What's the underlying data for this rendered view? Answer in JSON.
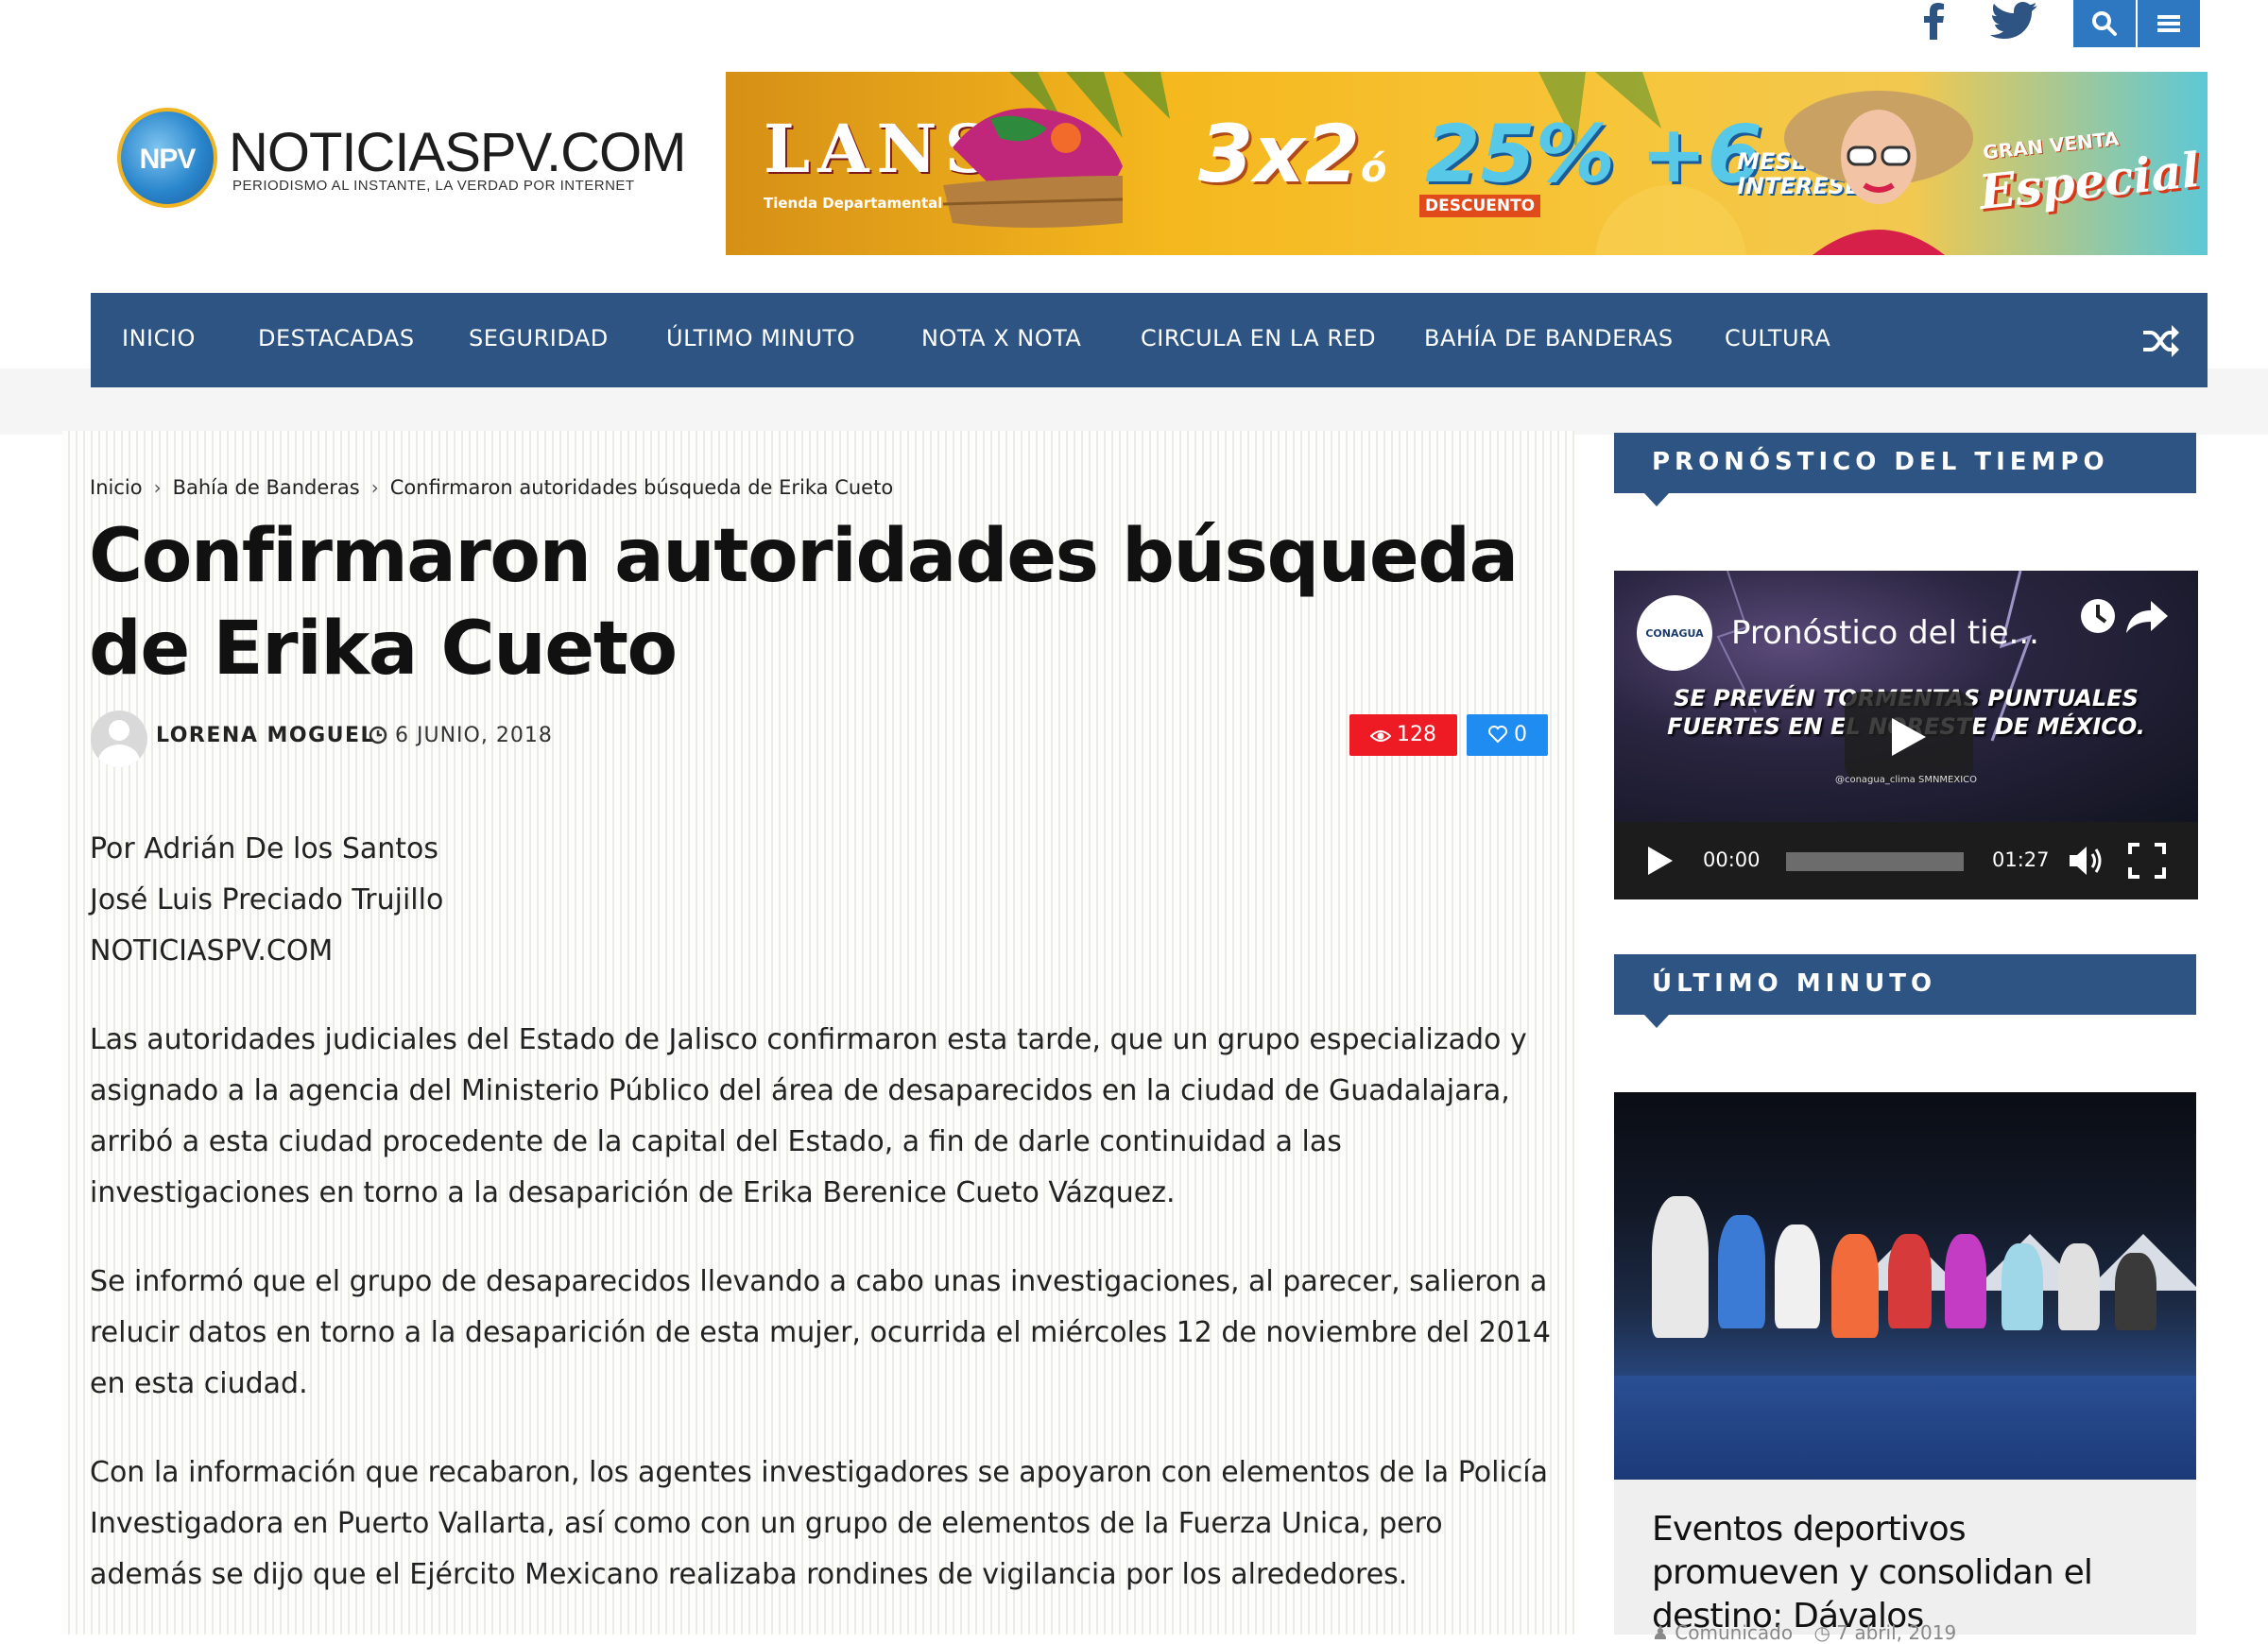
{
  "topbar": {
    "facebook_icon": "facebook-icon",
    "twitter_icon": "twitter-icon",
    "search_icon": "search-icon",
    "menu_icon": "hamburger-menu-icon",
    "accent_color": "#2e78c2"
  },
  "header": {
    "logo_mark": "NPV",
    "logo_name": "NOTICIASPV.COM",
    "logo_tagline": "PERIODISMO AL INSTANTE, LA VERDAD POR INTERNET"
  },
  "banner": {
    "brand": "LANS",
    "brand_sub": "Tienda Departamental",
    "promo_a": "3x2",
    "promo_or": "ó",
    "promo_b": "25%",
    "promo_b_sub": "DESCUENTO",
    "promo_c": "+6",
    "promo_c_sub_1": "MESES SIN",
    "promo_c_sub_2": "INTERESES",
    "sale_line_1": "GRAN VENTA",
    "sale_line_2": "Especial"
  },
  "nav": {
    "color": "#2d5482",
    "items": [
      "INICIO",
      "DESTACADAS",
      "SEGURIDAD",
      "ÚLTIMO MINUTO",
      "NOTA X NOTA",
      "CIRCULA EN LA RED",
      "BAHÍA DE BANDERAS",
      "CULTURA"
    ],
    "shuffle_icon": "shuffle-icon"
  },
  "breadcrumb": [
    "Inicio",
    "Bahía de Banderas",
    "Confirmaron autoridades búsqueda de Erika Cueto"
  ],
  "post": {
    "title": "Confirmaron autoridades búsqueda de Erika Cueto",
    "author": "LORENA MOGUEL",
    "date": "6 JUNIO, 2018",
    "views": "128",
    "likes": "0",
    "views_color": "#ee1b24",
    "likes_color": "#1e8cf0",
    "byline": [
      "Por Adrián De los Santos",
      "José Luis Preciado Trujillo",
      "NOTICIASPV.COM"
    ],
    "paragraphs": [
      "Las autoridades judiciales del Estado de Jalisco confirmaron esta tarde, que un grupo especializado y asignado a la agencia del Ministerio Público del área de desaparecidos en la ciudad de Guadalajara, arribó a esta ciudad procedente de la capital del Estado, a fin de darle continuidad a las investigaciones en torno a la desaparición de Erika Berenice Cueto Vázquez.",
      "Se informó que el grupo de desaparecidos llevando a cabo unas investigaciones, al parecer, salieron a relucir datos en torno a la desaparición de esta mujer, ocurrida el miércoles 12 de noviembre del 2014 en esta ciudad.",
      "Con la información que recabaron, los agentes investigadores se apoyaron con elementos de la Policía Investigadora en Puerto Vallarta, así como con un grupo de elementos de la Fuerza Unica, pero además se dijo que el Ejército Mexicano realizaba rondines de vigilancia por los alrededores."
    ]
  },
  "sidebar": {
    "weather_title": "PRONÓSTICO DEL TIEMPO",
    "video": {
      "channel": "CONAGUA",
      "title": "Pronóstico del tie...",
      "headline_1": "SE PREVÉN TORMENTAS PUNTUALES",
      "headline_2": "FUERTES EN EL NORESTE DE MÉXICO.",
      "socials": "@conagua_clima   SMNMEXICO",
      "current_time": "00:00",
      "duration": "01:27",
      "progress": 0
    },
    "latest_title": "ÚLTIMO MINUTO",
    "latest_card": {
      "title": "Eventos deportivos promueven y consolidan el destino: Dávalos",
      "author": "Comunicado",
      "date": "7 abril, 2019"
    }
  }
}
